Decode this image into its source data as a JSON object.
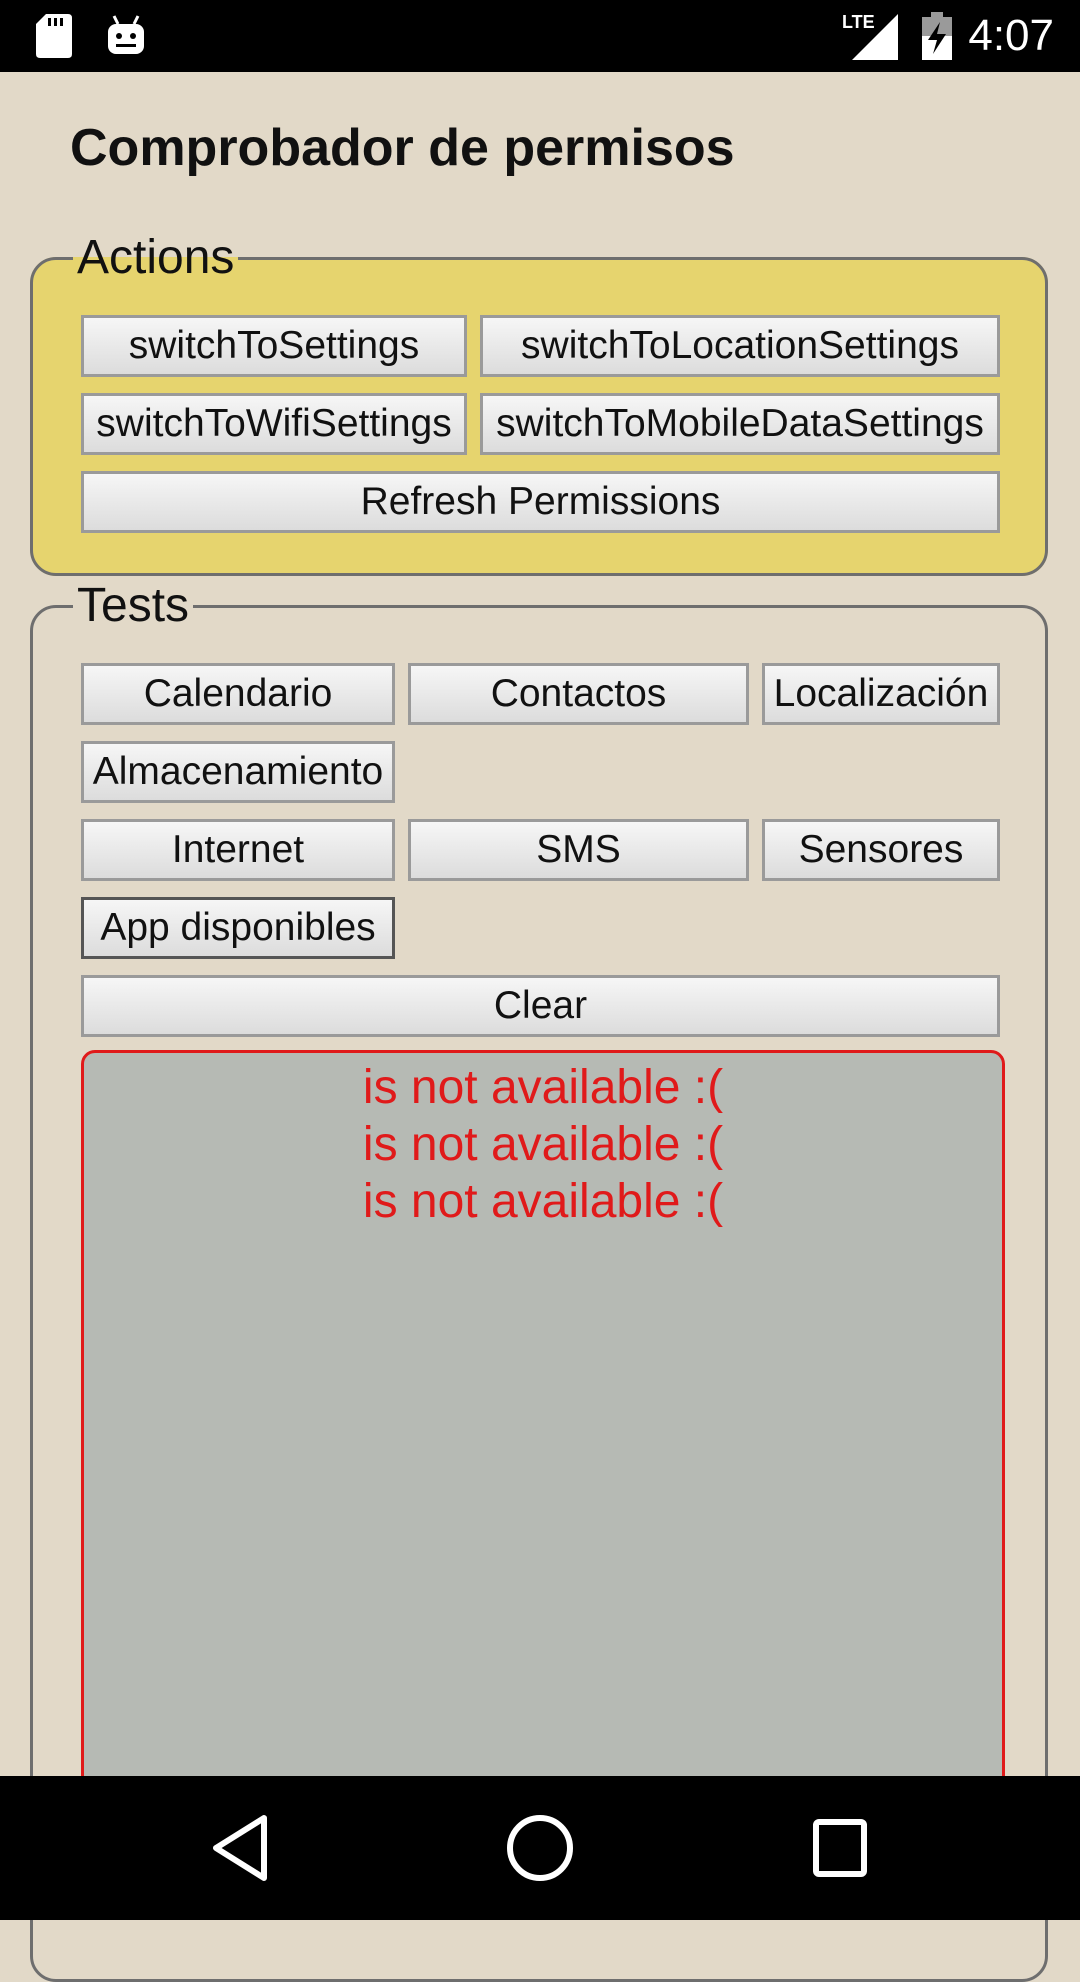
{
  "statusbar": {
    "time": "4:07",
    "icons": [
      "sd-card-icon",
      "android-icon",
      "lte-signal-icon",
      "battery-charging-icon"
    ],
    "network_label": "LTE"
  },
  "page": {
    "title": "Comprobador de permisos"
  },
  "actions": {
    "legend": "Actions",
    "buttons": [
      "switchToSettings",
      "switchToLocationSettings",
      "switchToWifiSettings",
      "switchToMobileDataSettings",
      "Refresh Permissions"
    ]
  },
  "tests": {
    "legend": "Tests",
    "buttons": [
      "Calendario",
      "Contactos",
      "Localización",
      "Almacenamiento",
      "Internet",
      "SMS",
      "Sensores",
      "App disponibles",
      "Clear"
    ],
    "output_lines": [
      "is not available :(",
      "is not available :(",
      "is not available :("
    ]
  },
  "navbar": {
    "icons": [
      "back-icon",
      "home-icon",
      "recents-icon"
    ]
  },
  "colors": {
    "background": "#e2d9c8",
    "actions_panel": "#e6d46e",
    "output_background": "#b6bab4",
    "error_text": "#e01a1a"
  }
}
